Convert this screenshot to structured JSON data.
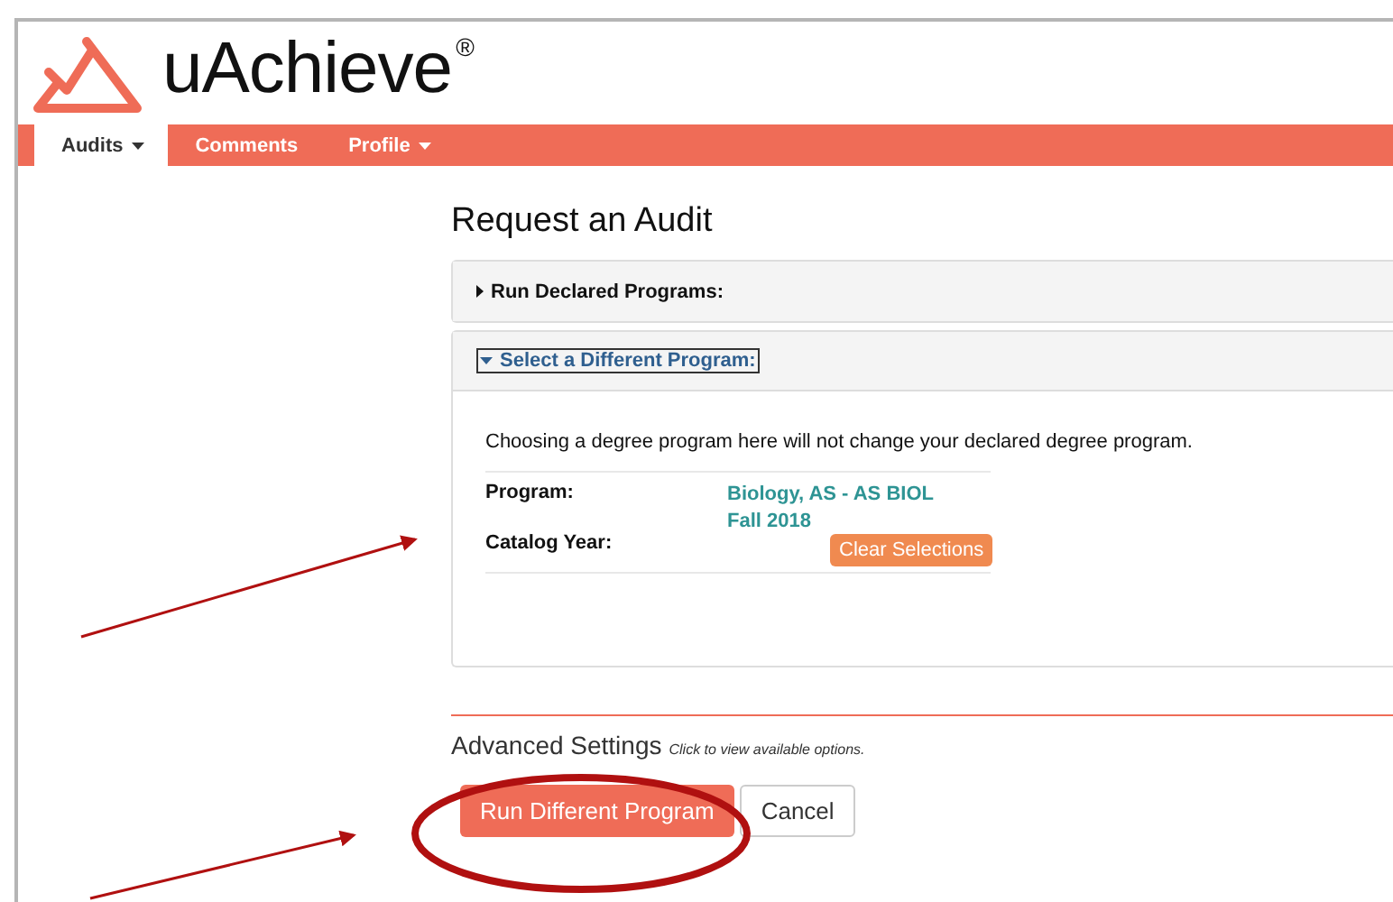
{
  "logo": {
    "name": "uAchieve",
    "mark": "®"
  },
  "nav": [
    {
      "label": "Audits",
      "selected": true,
      "dropdown": true
    },
    {
      "label": "Comments",
      "selected": false,
      "dropdown": false
    },
    {
      "label": "Profile",
      "selected": false,
      "dropdown": true
    }
  ],
  "title": "Request an Audit",
  "panels": [
    {
      "heading": "Run Declared Programs:",
      "expanded": false
    },
    {
      "heading": "Select a Different Program:",
      "expanded": true,
      "note": "Choosing a degree program here will not change your declared degree program.",
      "fields": [
        {
          "label": "Program:",
          "value": "Biology, AS - AS BIOL"
        },
        {
          "label": "Catalog Year:",
          "value": "Fall 2018"
        }
      ],
      "clear_button": "Clear Selections"
    }
  ],
  "advanced": {
    "label": "Advanced Settings",
    "hint": "Click to view available options."
  },
  "buttons": [
    {
      "label": "Run Different Program",
      "kind": "primary"
    },
    {
      "label": "Cancel",
      "kind": "default"
    }
  ]
}
